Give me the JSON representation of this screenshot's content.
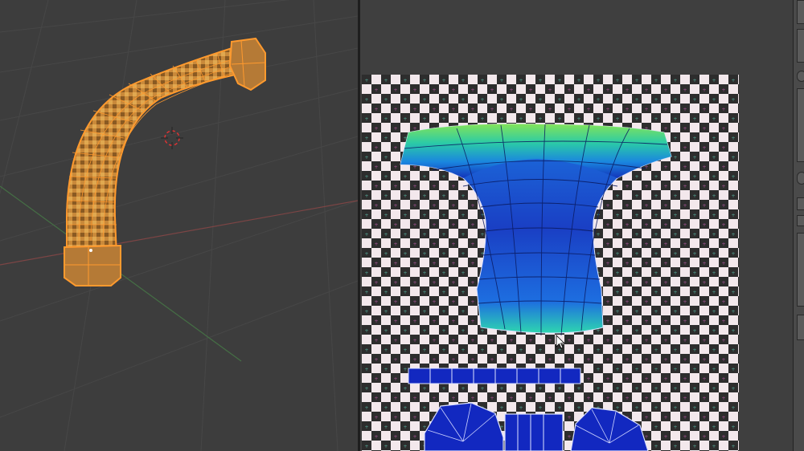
{
  "window": {
    "title": ""
  },
  "viewport3d": {
    "label": "3d-viewport"
  },
  "uv_editor": {
    "label": "uv-image-editor"
  },
  "colors": {
    "background": "#3d3d3d",
    "grid": "#464646",
    "axis_x": "#8a4646",
    "axis_y": "#4b7a4b",
    "selection": "#ff9a2e",
    "checker_light": "#f4e9ec",
    "checker_dark": "#2e2e2e",
    "uv_blue": "#1326b8"
  },
  "icons": [
    "3d-cursor-icon",
    "mouse-cursor-icon"
  ]
}
